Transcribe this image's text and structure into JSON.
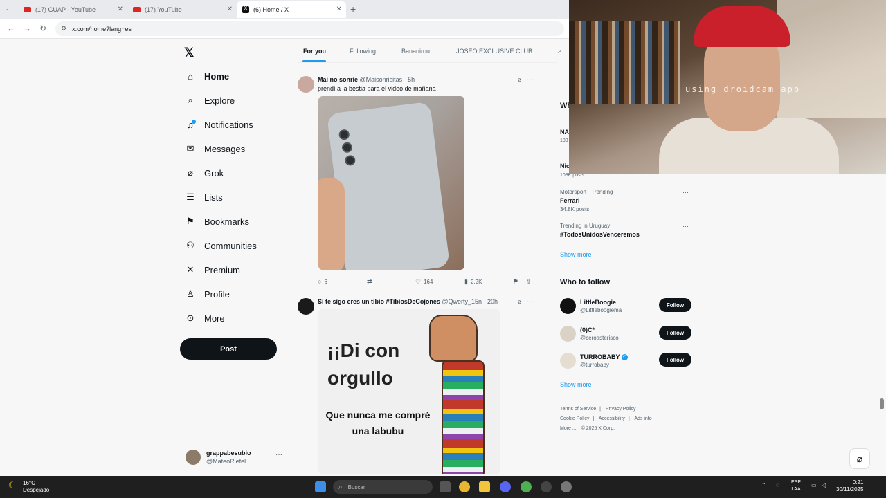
{
  "browser": {
    "tabs": [
      {
        "title": "(17) GUAP - YouTube",
        "favicon": "youtube-icon",
        "active": false
      },
      {
        "title": "(17) YouTube",
        "favicon": "youtube-icon",
        "active": false
      },
      {
        "title": "(6) Home / X",
        "favicon": "x-icon",
        "active": true
      }
    ],
    "url": "x.com/home?lang=es"
  },
  "sidebar": {
    "items": [
      {
        "label": "Home",
        "icon": "home-icon"
      },
      {
        "label": "Explore",
        "icon": "search-icon"
      },
      {
        "label": "Notifications",
        "icon": "bell-icon"
      },
      {
        "label": "Messages",
        "icon": "mail-icon"
      },
      {
        "label": "Grok",
        "icon": "grok-icon"
      },
      {
        "label": "Lists",
        "icon": "list-icon"
      },
      {
        "label": "Bookmarks",
        "icon": "bookmark-icon"
      },
      {
        "label": "Communities",
        "icon": "people-icon"
      },
      {
        "label": "Premium",
        "icon": "x-icon"
      },
      {
        "label": "Profile",
        "icon": "person-icon"
      },
      {
        "label": "More",
        "icon": "more-circle-icon"
      }
    ],
    "post_label": "Post",
    "account": {
      "name": "grappabesubio",
      "handle": "@MateoRlefel"
    }
  },
  "feed": {
    "tabs": [
      "For you",
      "Following",
      "Bananirou",
      "JOSEO EXCLUSIVE CLUB"
    ],
    "tweets": [
      {
        "name": "Mai no sonrie",
        "handle_time": "@Maisonrisitas · 5h",
        "text": "prendí a la bestia para el video de mañana",
        "replies": "6",
        "likes": "164",
        "views": "2.2K"
      },
      {
        "name": "Si te sigo eres un tibio #TibiosDeCojones",
        "handle_time": "@Qwerty_15n · 20h",
        "meme_title": "¡¡Di con orgullo",
        "meme_sub": "Que nunca me compré una labubu"
      }
    ]
  },
  "right": {
    "partial_title": "Wh",
    "partial_rows": [
      {
        "name": "NA",
        "sub": "183"
      },
      {
        "name": "Nic",
        "sub": "108K posts"
      }
    ],
    "trends": [
      {
        "category": "Motorsport · Trending",
        "name": "Ferrari",
        "posts": "34.8K posts"
      },
      {
        "category": "Trending in Uruguay",
        "name": "#TodosUnidosVenceremos",
        "posts": ""
      }
    ],
    "show_more": "Show more",
    "who_to_follow_title": "Who to follow",
    "follow_label": "Follow",
    "suggestions": [
      {
        "name": "LittleBoogie",
        "handle": "@Littleboogiema",
        "verified": false
      },
      {
        "name": "(0)C*",
        "handle": "@ceroasterisco",
        "verified": false
      },
      {
        "name": "TURROBABY",
        "handle": "@turrobaby",
        "verified": true
      }
    ],
    "footer": [
      "Terms of Service",
      "|",
      "Privacy Policy",
      "|",
      "Cookie Policy",
      "|",
      "Accessibility",
      "|",
      "Ads info",
      "|",
      "More ...",
      "© 2025 X Corp."
    ]
  },
  "webcam": {
    "watermark": "using droidcam app"
  },
  "taskbar": {
    "temperature": "16°C",
    "weather": "Despejado",
    "search_placeholder": "Buscar",
    "lang_top": "ESP",
    "lang_bottom": "LAA",
    "time": "0:21",
    "date": "30/11/2025"
  },
  "colors": {
    "accent": "#1d9bf0",
    "text": "#0f1419",
    "muted": "#536471"
  }
}
